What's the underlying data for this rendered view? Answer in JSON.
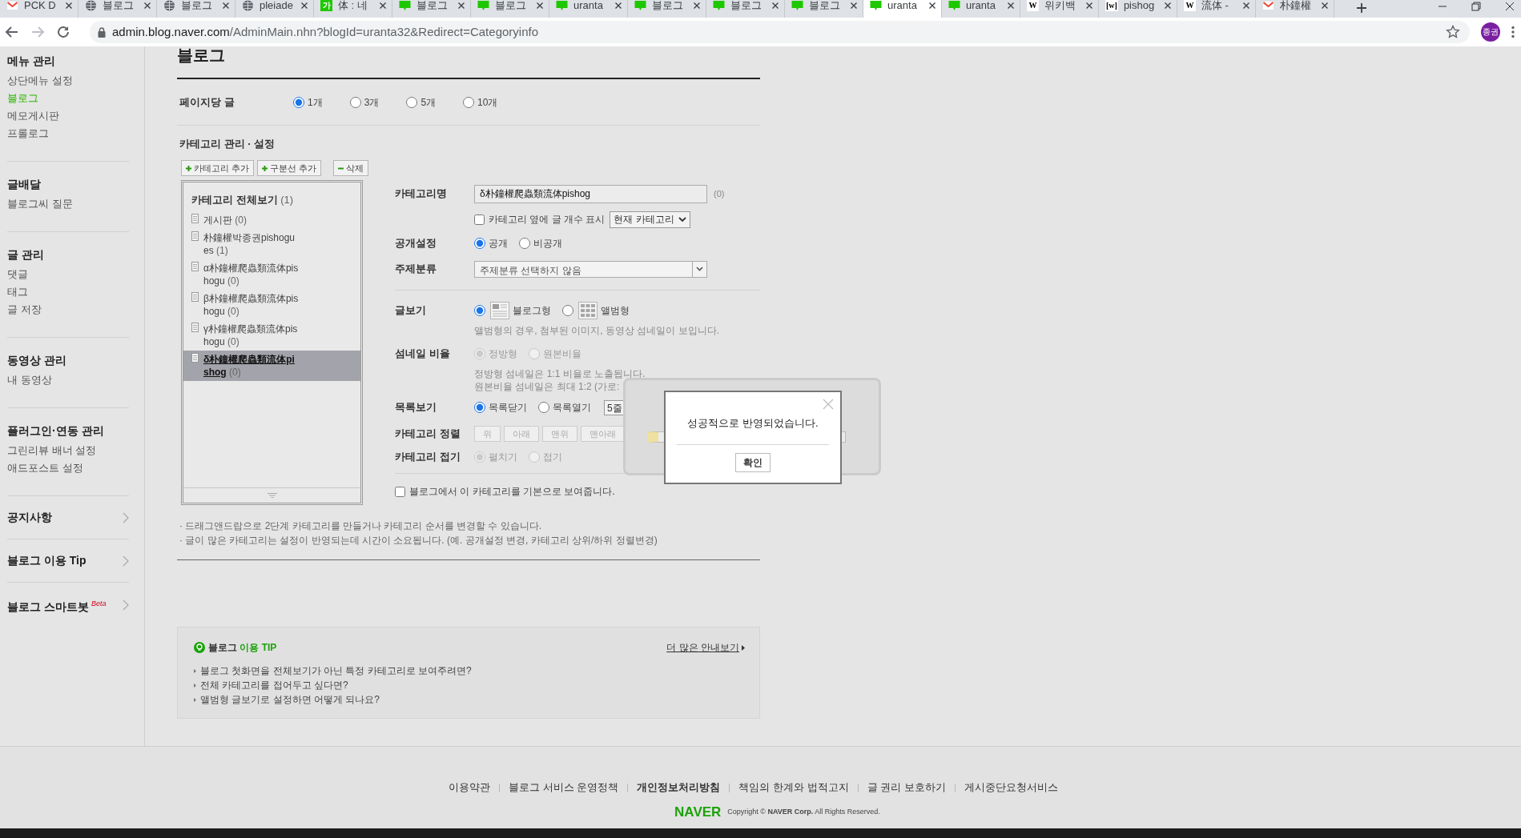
{
  "browser": {
    "tabs": [
      {
        "label": "PCK D",
        "kind": "mail",
        "selected": false
      },
      {
        "label": "블로그",
        "kind": "globe",
        "selected": false
      },
      {
        "label": "블로그",
        "kind": "globe",
        "selected": false
      },
      {
        "label": "pleiade",
        "kind": "globe",
        "selected": false
      },
      {
        "label": "体 : 네",
        "kind": "ga",
        "icon_text": "가",
        "selected": false
      },
      {
        "label": "블로그",
        "kind": "blog",
        "selected": false
      },
      {
        "label": "블로그",
        "kind": "blog",
        "selected": false
      },
      {
        "label": "uranta",
        "kind": "blog",
        "selected": false
      },
      {
        "label": "블로그",
        "kind": "blog",
        "selected": false
      },
      {
        "label": "블로그",
        "kind": "blog",
        "selected": false
      },
      {
        "label": "블로그",
        "kind": "blog",
        "selected": false
      },
      {
        "label": "uranta",
        "kind": "blog",
        "selected": true
      },
      {
        "label": "uranta",
        "kind": "blog",
        "selected": false
      },
      {
        "label": "위키백",
        "kind": "wiki",
        "icon_text": "W",
        "selected": false
      },
      {
        "label": "pishog",
        "kind": "wiki",
        "icon_text": "[w]",
        "selected": false
      },
      {
        "label": "流体 -",
        "kind": "wiki",
        "icon_text": "W",
        "selected": false
      },
      {
        "label": "朴鐘權",
        "kind": "mail",
        "selected": false
      }
    ],
    "url_host": "admin.blog.naver.com",
    "url_path": "/AdminMain.nhn?blogId=uranta32&Redirect=Categoryinfo",
    "profile": "종권"
  },
  "sidebar": {
    "sections": [
      {
        "title": "메뉴 관리",
        "items": [
          {
            "label": "상단메뉴 설정",
            "selected": false
          },
          {
            "label": "블로그",
            "selected": true
          },
          {
            "label": "메모게시판",
            "selected": false
          },
          {
            "label": "프롤로그",
            "selected": false
          }
        ]
      },
      {
        "title": "글배달",
        "items": [
          {
            "label": "블로그씨 질문",
            "selected": false
          }
        ]
      },
      {
        "title": "글 관리",
        "items": [
          {
            "label": "댓글",
            "selected": false
          },
          {
            "label": "태그",
            "selected": false
          },
          {
            "label": "글 저장",
            "selected": false
          }
        ]
      },
      {
        "title": "동영상 관리",
        "items": [
          {
            "label": "내 동영상",
            "selected": false
          }
        ]
      },
      {
        "title": "플러그인·연동 관리",
        "items": [
          {
            "label": "그린리뷰 배너 설정",
            "selected": false
          },
          {
            "label": "애드포스트 설정",
            "selected": false
          }
        ]
      }
    ],
    "links": [
      {
        "label": "공지사항"
      },
      {
        "label": "블로그 이용 Tip"
      },
      {
        "label": "블로그 스마트봇",
        "badge": "Beta"
      }
    ]
  },
  "page": {
    "title": "블로그",
    "per_page": {
      "label": "페이지당 글",
      "options": [
        {
          "label": "1개",
          "selected": true
        },
        {
          "label": "3개",
          "selected": false
        },
        {
          "label": "5개",
          "selected": false
        },
        {
          "label": "10개",
          "selected": false
        }
      ]
    },
    "category_title": "카테고리 관리 · 설정",
    "toolbar": [
      {
        "label": "카테고리 추가",
        "kind": "add"
      },
      {
        "label": "구분선 추가",
        "kind": "add"
      },
      {
        "label": "삭제",
        "kind": "delete"
      }
    ],
    "tree": {
      "title": "카테고리 전체보기",
      "count": "(1)",
      "items": [
        {
          "name": "게시판",
          "count": "(0)",
          "selected": false
        },
        {
          "name": "朴鐘權박종권pishogues",
          "count": "(1)",
          "selected": false
        },
        {
          "name": "α朴鐘權爬蟲類流体pishogu",
          "count": "(0)",
          "selected": false
        },
        {
          "name": "β朴鐘權爬蟲類流体pishogu",
          "count": "(0)",
          "selected": false
        },
        {
          "name": "γ朴鐘權爬蟲類流体pishogu",
          "count": "(0)",
          "selected": false
        },
        {
          "name": "δ朴鐘權爬蟲類流体pishog",
          "count": "(0)",
          "selected": true
        }
      ]
    },
    "form": {
      "name": {
        "label": "카테고리명",
        "value": "δ朴鐘權爬蟲類流体pishog",
        "count": "(0)"
      },
      "count_display": {
        "label": "카테고리 옆에 글 개수 표시",
        "checked": false,
        "select": "현재 카테고리"
      },
      "visibility": {
        "label": "공개설정",
        "options": [
          {
            "label": "공개",
            "selected": true
          },
          {
            "label": "비공개",
            "selected": false
          }
        ]
      },
      "topic": {
        "label": "주제분류",
        "value": "주제분류 선택하지 않음"
      },
      "view": {
        "label": "글보기",
        "options": [
          {
            "label": "블로그형",
            "kind": "blog",
            "selected": true
          },
          {
            "label": "앨범형",
            "kind": "album",
            "selected": false
          }
        ],
        "hint": "앨범형의 경우, 첨부된 이미지, 동영상 섬네일이 보입니다."
      },
      "thumbnail": {
        "label": "섬네일 비율",
        "disabled": true,
        "options": [
          {
            "label": "정방형",
            "selected": true
          },
          {
            "label": "원본비율",
            "selected": false
          }
        ],
        "hints": [
          "정방형 섬네일은 1:1 비율로 노출됩니다.",
          "원본비율 섬네일은 최대 1:2 (가로:"
        ]
      },
      "list_view": {
        "label": "목록보기",
        "options": [
          {
            "label": "목록닫기",
            "selected": true
          },
          {
            "label": "목록열기",
            "selected": false
          }
        ],
        "select": "5줄"
      },
      "sort": {
        "label": "카테고리 정렬",
        "disabled": true,
        "buttons": [
          "위",
          "아래",
          "맨위",
          "맨아래"
        ]
      },
      "fold": {
        "label": "카테고리 접기",
        "disabled": true,
        "options": [
          {
            "label": "펼치기",
            "selected": true
          },
          {
            "label": "접기",
            "selected": false
          }
        ]
      },
      "default_view": {
        "label": "블로그에서 이 카테고리를 기본으로 보여줍니다.",
        "checked": false
      }
    },
    "notes": [
      "· 드래그앤드랍으로 2단계 카테고리를 만들거나 카테고리 순서를 변경할 수 있습니다.",
      "· 글이 많은 카테고리는 설정이 반영되는데 시간이 소요됩니다. (예. 공개설정 변경, 카테고리 상위/하위 정렬변경)"
    ],
    "tip": {
      "title": "블로그",
      "title_accent": "이용 TIP",
      "more": "더 많은 안내보기",
      "items": [
        "블로그 첫화면을 전체보기가 아닌 특정 카테고리로 보여주려면?",
        "전체 카테고리를 접어두고 싶다면?",
        "앨범형 글보기로 설정하면 어떻게 되나요?"
      ]
    }
  },
  "footer": {
    "links": [
      {
        "label": "이용약관",
        "bold": false
      },
      {
        "label": "블로그 서비스 운영정책",
        "bold": false
      },
      {
        "label": "개인정보처리방침",
        "bold": true
      },
      {
        "label": "책임의 한계와 법적고지",
        "bold": false
      },
      {
        "label": "글 권리 보호하기",
        "bold": false
      },
      {
        "label": "게시중단요청서비스",
        "bold": false
      }
    ],
    "logo": "NAVER",
    "copyright": "Copyright © **NAVER Corp.** All Rights Reserved."
  },
  "dialog": {
    "message": "성공적으로 반영되었습니다.",
    "button": "확인"
  }
}
